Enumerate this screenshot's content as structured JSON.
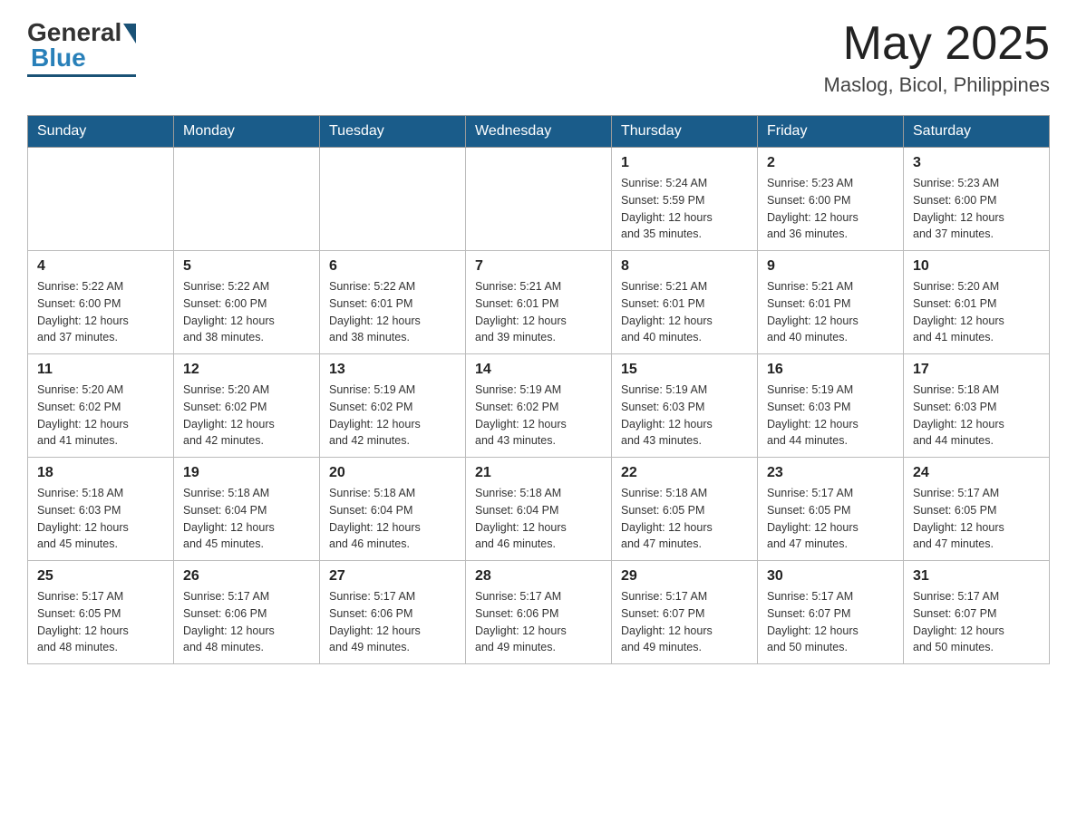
{
  "header": {
    "logo_general": "General",
    "logo_blue": "Blue",
    "month_year": "May 2025",
    "location": "Maslog, Bicol, Philippines"
  },
  "days_of_week": [
    "Sunday",
    "Monday",
    "Tuesday",
    "Wednesday",
    "Thursday",
    "Friday",
    "Saturday"
  ],
  "weeks": [
    [
      {
        "day": "",
        "info": ""
      },
      {
        "day": "",
        "info": ""
      },
      {
        "day": "",
        "info": ""
      },
      {
        "day": "",
        "info": ""
      },
      {
        "day": "1",
        "info": "Sunrise: 5:24 AM\nSunset: 5:59 PM\nDaylight: 12 hours\nand 35 minutes."
      },
      {
        "day": "2",
        "info": "Sunrise: 5:23 AM\nSunset: 6:00 PM\nDaylight: 12 hours\nand 36 minutes."
      },
      {
        "day": "3",
        "info": "Sunrise: 5:23 AM\nSunset: 6:00 PM\nDaylight: 12 hours\nand 37 minutes."
      }
    ],
    [
      {
        "day": "4",
        "info": "Sunrise: 5:22 AM\nSunset: 6:00 PM\nDaylight: 12 hours\nand 37 minutes."
      },
      {
        "day": "5",
        "info": "Sunrise: 5:22 AM\nSunset: 6:00 PM\nDaylight: 12 hours\nand 38 minutes."
      },
      {
        "day": "6",
        "info": "Sunrise: 5:22 AM\nSunset: 6:01 PM\nDaylight: 12 hours\nand 38 minutes."
      },
      {
        "day": "7",
        "info": "Sunrise: 5:21 AM\nSunset: 6:01 PM\nDaylight: 12 hours\nand 39 minutes."
      },
      {
        "day": "8",
        "info": "Sunrise: 5:21 AM\nSunset: 6:01 PM\nDaylight: 12 hours\nand 40 minutes."
      },
      {
        "day": "9",
        "info": "Sunrise: 5:21 AM\nSunset: 6:01 PM\nDaylight: 12 hours\nand 40 minutes."
      },
      {
        "day": "10",
        "info": "Sunrise: 5:20 AM\nSunset: 6:01 PM\nDaylight: 12 hours\nand 41 minutes."
      }
    ],
    [
      {
        "day": "11",
        "info": "Sunrise: 5:20 AM\nSunset: 6:02 PM\nDaylight: 12 hours\nand 41 minutes."
      },
      {
        "day": "12",
        "info": "Sunrise: 5:20 AM\nSunset: 6:02 PM\nDaylight: 12 hours\nand 42 minutes."
      },
      {
        "day": "13",
        "info": "Sunrise: 5:19 AM\nSunset: 6:02 PM\nDaylight: 12 hours\nand 42 minutes."
      },
      {
        "day": "14",
        "info": "Sunrise: 5:19 AM\nSunset: 6:02 PM\nDaylight: 12 hours\nand 43 minutes."
      },
      {
        "day": "15",
        "info": "Sunrise: 5:19 AM\nSunset: 6:03 PM\nDaylight: 12 hours\nand 43 minutes."
      },
      {
        "day": "16",
        "info": "Sunrise: 5:19 AM\nSunset: 6:03 PM\nDaylight: 12 hours\nand 44 minutes."
      },
      {
        "day": "17",
        "info": "Sunrise: 5:18 AM\nSunset: 6:03 PM\nDaylight: 12 hours\nand 44 minutes."
      }
    ],
    [
      {
        "day": "18",
        "info": "Sunrise: 5:18 AM\nSunset: 6:03 PM\nDaylight: 12 hours\nand 45 minutes."
      },
      {
        "day": "19",
        "info": "Sunrise: 5:18 AM\nSunset: 6:04 PM\nDaylight: 12 hours\nand 45 minutes."
      },
      {
        "day": "20",
        "info": "Sunrise: 5:18 AM\nSunset: 6:04 PM\nDaylight: 12 hours\nand 46 minutes."
      },
      {
        "day": "21",
        "info": "Sunrise: 5:18 AM\nSunset: 6:04 PM\nDaylight: 12 hours\nand 46 minutes."
      },
      {
        "day": "22",
        "info": "Sunrise: 5:18 AM\nSunset: 6:05 PM\nDaylight: 12 hours\nand 47 minutes."
      },
      {
        "day": "23",
        "info": "Sunrise: 5:17 AM\nSunset: 6:05 PM\nDaylight: 12 hours\nand 47 minutes."
      },
      {
        "day": "24",
        "info": "Sunrise: 5:17 AM\nSunset: 6:05 PM\nDaylight: 12 hours\nand 47 minutes."
      }
    ],
    [
      {
        "day": "25",
        "info": "Sunrise: 5:17 AM\nSunset: 6:05 PM\nDaylight: 12 hours\nand 48 minutes."
      },
      {
        "day": "26",
        "info": "Sunrise: 5:17 AM\nSunset: 6:06 PM\nDaylight: 12 hours\nand 48 minutes."
      },
      {
        "day": "27",
        "info": "Sunrise: 5:17 AM\nSunset: 6:06 PM\nDaylight: 12 hours\nand 49 minutes."
      },
      {
        "day": "28",
        "info": "Sunrise: 5:17 AM\nSunset: 6:06 PM\nDaylight: 12 hours\nand 49 minutes."
      },
      {
        "day": "29",
        "info": "Sunrise: 5:17 AM\nSunset: 6:07 PM\nDaylight: 12 hours\nand 49 minutes."
      },
      {
        "day": "30",
        "info": "Sunrise: 5:17 AM\nSunset: 6:07 PM\nDaylight: 12 hours\nand 50 minutes."
      },
      {
        "day": "31",
        "info": "Sunrise: 5:17 AM\nSunset: 6:07 PM\nDaylight: 12 hours\nand 50 minutes."
      }
    ]
  ]
}
